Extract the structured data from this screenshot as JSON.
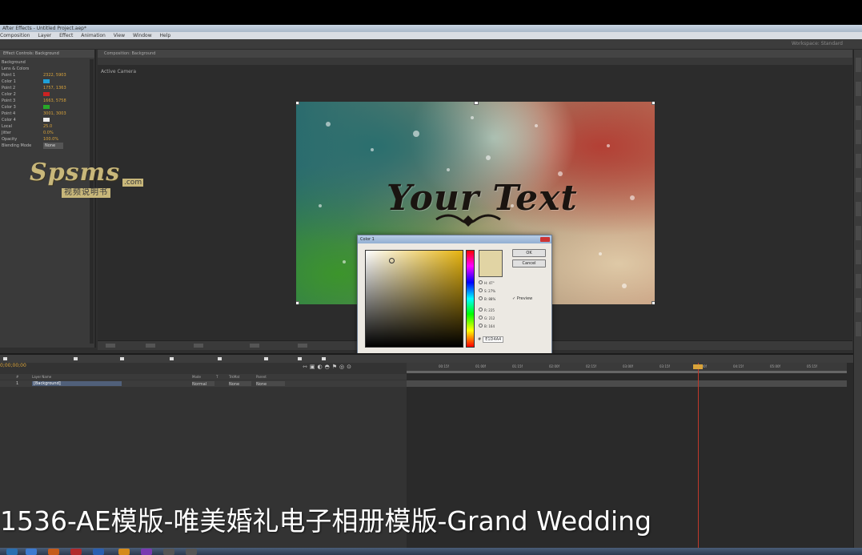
{
  "window": {
    "title": "After Effects - Untitled Project.aep*"
  },
  "menu": [
    "Composition",
    "Layer",
    "Effect",
    "Animation",
    "View",
    "Window",
    "Help"
  ],
  "workspace": {
    "label": "Workspace: Standard"
  },
  "effect_controls": {
    "tab": "Effect Controls: Background",
    "properties": [
      {
        "label": "Background",
        "value": ""
      },
      {
        "label": "Lens & Colors",
        "value": ""
      },
      {
        "label": "Point 1",
        "value": "2322, 5903"
      },
      {
        "label": "Color 1",
        "value": ""
      },
      {
        "label": "Point 2",
        "value": "1757, 1363"
      },
      {
        "label": "Color 2",
        "value": ""
      },
      {
        "label": "Point 3",
        "value": "1663, 5758"
      },
      {
        "label": "Color 3",
        "value": ""
      },
      {
        "label": "Point 4",
        "value": "3001, 3003"
      },
      {
        "label": "Color 4",
        "value": ""
      },
      {
        "label": "Local",
        "value": "25.0"
      },
      {
        "label": "Jitter",
        "value": "0.0%"
      },
      {
        "label": "Opacity",
        "value": "100.0%"
      },
      {
        "label": "Blending Mode",
        "value": "None"
      }
    ],
    "colors": [
      "",
      "#1fa0d8",
      "",
      "#cc2222",
      "",
      "#28a828",
      "",
      "#eeeeee"
    ]
  },
  "composition": {
    "tab": "Composition: Background",
    "camera": "Active Camera",
    "canvas_text": "Your Text"
  },
  "logo": {
    "main": "Spsms",
    "com": ".com",
    "cn": "视频说明书"
  },
  "color_dialog": {
    "title": "Color 1",
    "ok": "OK",
    "cancel": "Cancel",
    "preview": "Preview",
    "hex": "E1D4A4",
    "fields": [
      "H: 47°",
      "S: 27%",
      "B: 88%",
      "R: 225",
      "G: 212",
      "B: 164"
    ],
    "selected_color": "#e1d4a4"
  },
  "timeline": {
    "time": "0;00;00;00",
    "columns": [
      "#",
      "Layer Name",
      "Mode",
      "T",
      "TrkMat",
      "Parent"
    ],
    "layer": {
      "index": "1",
      "name": "[Background]",
      "mode": "Normal",
      "trkmat": "None",
      "parent": "None"
    },
    "ruler": [
      "00:15f",
      "01:00f",
      "01:15f",
      "02:00f",
      "02:15f",
      "03:00f",
      "03:15f",
      "04:00f",
      "04:15f",
      "05:00f",
      "05:15f"
    ]
  },
  "caption": "1536-AE模版-唯美婚礼电子相册模版-Grand Wedding"
}
